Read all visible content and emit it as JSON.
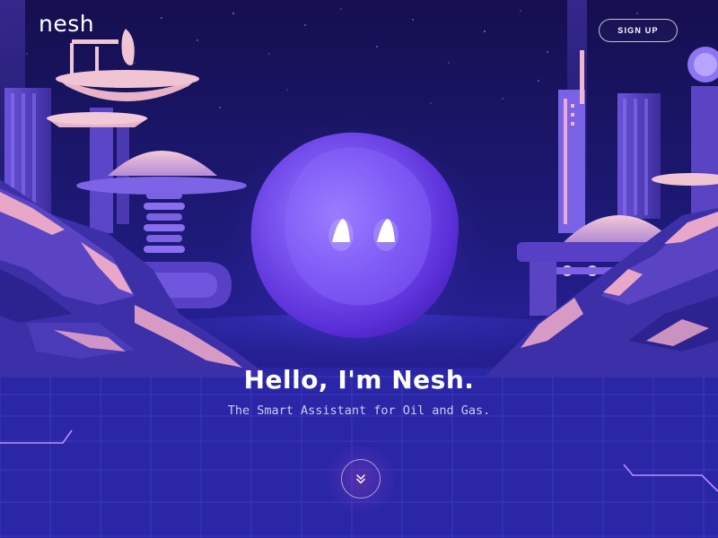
{
  "brand": {
    "logo_text": "nesh"
  },
  "header": {
    "signup_label": "SIGN UP"
  },
  "hero": {
    "title": "Hello, I'm Nesh.",
    "subtitle": "The Smart Assistant for Oil and Gas."
  },
  "icons": {
    "scroll": "chevron-double-down-icon"
  },
  "colors": {
    "background": "#1e1a7a",
    "orb": "#7b55f0",
    "accent_pink": "#e8a6c8",
    "text": "#ffffff"
  }
}
